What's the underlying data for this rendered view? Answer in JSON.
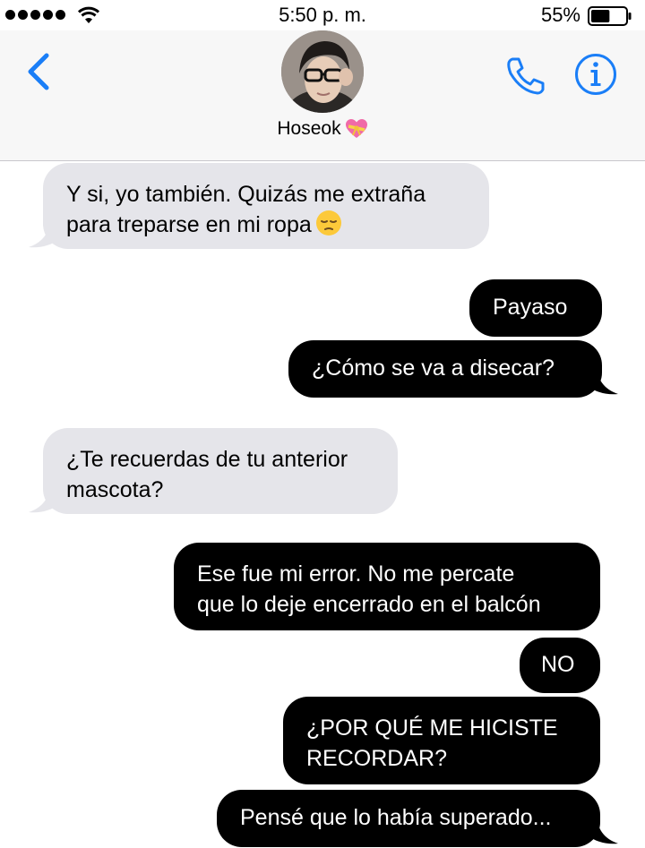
{
  "status_bar": {
    "time": "5:50 p. m.",
    "battery_percent": "55%",
    "battery_level": 0.55,
    "signal_icon": "signal-dots-icon",
    "wifi_icon": "wifi-icon"
  },
  "header": {
    "contact_name": "Hoseok",
    "contact_emoji": "heart-with-ribbon-icon",
    "back_icon": "chevron-left-icon",
    "call_icon": "phone-icon",
    "info_icon": "info-icon",
    "accent_color": "#1a7ef7"
  },
  "messages": [
    {
      "direction": "incoming",
      "lines": [
        "Y si, yo también. Quizás me extraña",
        "para treparse en mi ropa"
      ],
      "emoji": "pensive-face-icon"
    },
    {
      "direction": "outgoing",
      "lines": [
        "Payaso"
      ]
    },
    {
      "direction": "outgoing",
      "lines": [
        "¿Cómo se va a disecar?"
      ]
    },
    {
      "direction": "incoming",
      "lines": [
        "¿Te recuerdas de tu anterior",
        "mascota?"
      ]
    },
    {
      "direction": "outgoing",
      "lines": [
        "Ese fue mi error. No me percate",
        "que lo deje encerrado en el balcón"
      ]
    },
    {
      "direction": "outgoing",
      "lines": [
        "NO"
      ]
    },
    {
      "direction": "outgoing",
      "lines": [
        "¿POR QUÉ ME HICISTE",
        "RECORDAR?"
      ]
    },
    {
      "direction": "outgoing",
      "lines": [
        "Pensé que lo había superado..."
      ]
    }
  ],
  "colors": {
    "incoming_bubble": "#e5e5ea",
    "outgoing_bubble": "#000000",
    "outgoing_text": "#ffffff"
  }
}
